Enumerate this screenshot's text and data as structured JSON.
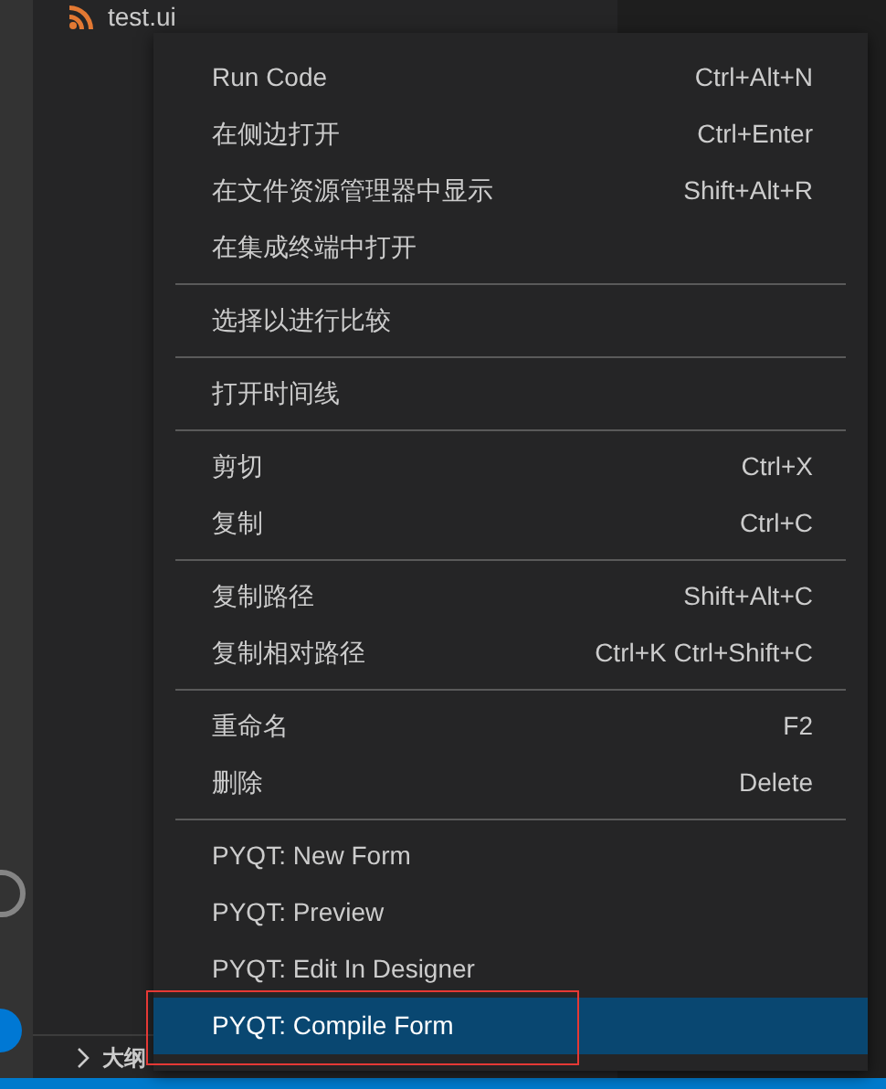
{
  "explorer": {
    "file": "test.ui"
  },
  "context_menu": {
    "groups": [
      [
        {
          "label": "Run Code",
          "shortcut": "Ctrl+Alt+N",
          "selected": false
        },
        {
          "label": "在侧边打开",
          "shortcut": "Ctrl+Enter",
          "selected": false
        },
        {
          "label": "在文件资源管理器中显示",
          "shortcut": "Shift+Alt+R",
          "selected": false
        },
        {
          "label": "在集成终端中打开",
          "selected": false
        }
      ],
      [
        {
          "label": "选择以进行比较",
          "selected": false
        }
      ],
      [
        {
          "label": "打开时间线",
          "selected": false
        }
      ],
      [
        {
          "label": "剪切",
          "shortcut": "Ctrl+X",
          "selected": false
        },
        {
          "label": "复制",
          "shortcut": "Ctrl+C",
          "selected": false
        }
      ],
      [
        {
          "label": "复制路径",
          "shortcut": "Shift+Alt+C",
          "selected": false
        },
        {
          "label": "复制相对路径",
          "shortcut": "Ctrl+K Ctrl+Shift+C",
          "selected": false
        }
      ],
      [
        {
          "label": "重命名",
          "shortcut": "F2",
          "selected": false
        },
        {
          "label": "删除",
          "shortcut": "Delete",
          "selected": false
        }
      ],
      [
        {
          "label": "PYQT: New Form",
          "selected": false
        },
        {
          "label": "PYQT: Preview",
          "selected": false
        },
        {
          "label": "PYQT: Edit In Designer",
          "selected": false
        },
        {
          "label": "PYQT: Compile Form",
          "selected": true,
          "highlighted": true
        }
      ]
    ]
  },
  "outline": {
    "label": "大纲"
  }
}
